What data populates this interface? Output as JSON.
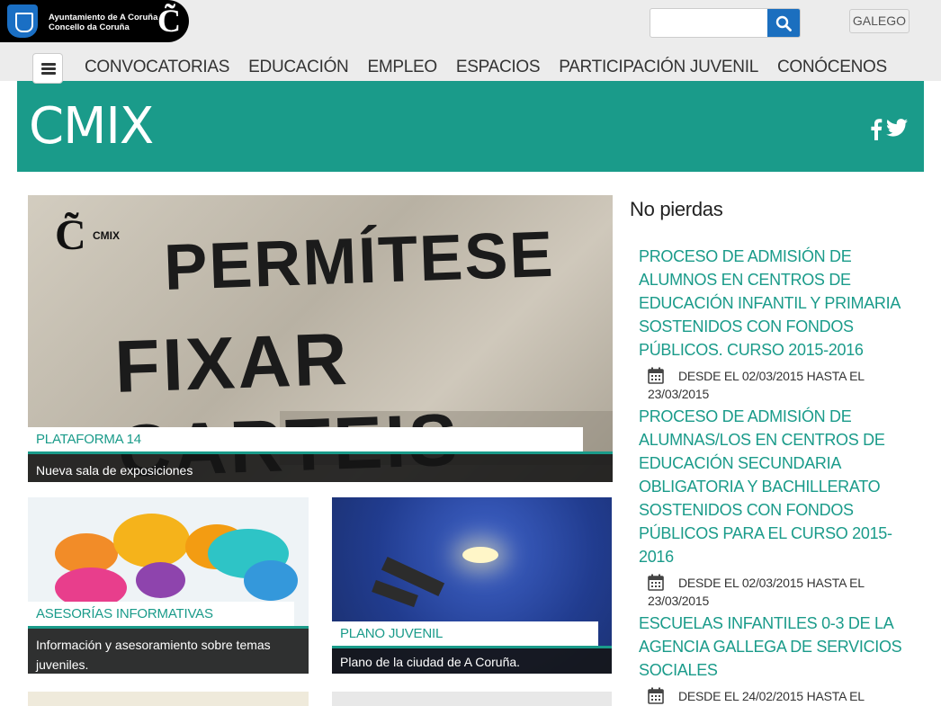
{
  "header": {
    "logo_line1": "Ayuntamiento de A Coruña",
    "logo_line2": "Concello da Coruña",
    "logo_mark": "C̃",
    "search": {
      "placeholder": ""
    },
    "language_label": "GALEGO"
  },
  "nav": {
    "items": [
      {
        "label": "CONVOCATORIAS"
      },
      {
        "label": "EDUCACIÓN"
      },
      {
        "label": "EMPLEO"
      },
      {
        "label": "ESPACIOS"
      },
      {
        "label": "PARTICIPACIÓN JUVENIL"
      },
      {
        "label": "CONÓCENOS"
      }
    ]
  },
  "banner": {
    "title": "CMIX",
    "color": "#1a9b8a",
    "social_icons": [
      "facebook-icon",
      "twitter-icon"
    ]
  },
  "features": [
    {
      "tag": "PLATAFORMA 14",
      "caption": "Nueva sala de exposiciones",
      "poster_line1": "PERMÍTESE",
      "poster_line2": "FIXAR CARTEIS",
      "poster_brand": "CMIX"
    },
    {
      "tag": "ASESORÍAS INFORMATIVAS",
      "caption": "Información y asesoramiento sobre temas juveniles."
    },
    {
      "tag": "PLANO JUVENIL",
      "caption": "Plano de la ciudad de A Coruña."
    }
  ],
  "sidebar": {
    "title": "No pierdas",
    "items": [
      {
        "title": "PROCESO DE ADMISIÓN DE ALUMNOS EN CENTROS DE EDUCACIÓN INFANTIL Y PRIMARIA SOSTENIDOS CON FONDOS PÚBLICOS. CURSO 2015-2016",
        "date": "DESDE EL 02/03/2015 HASTA EL 23/03/2015"
      },
      {
        "title": "PROCESO DE ADMISIÓN DE ALUMNAS/LOS EN CENTROS DE EDUCACIÓN SECUNDARIA OBLIGATORIA Y BACHILLERATO SOSTENIDOS CON FONDOS PÚBLICOS PARA EL CURSO 2015-2016",
        "date": "DESDE EL 02/03/2015 HASTA EL 23/03/2015"
      },
      {
        "title": "ESCUELAS INFANTILES 0-3 DE LA AGENCIA GALLEGA DE SERVICIOS SOCIALES",
        "date": "DESDE EL 24/02/2015 HASTA EL"
      }
    ]
  }
}
